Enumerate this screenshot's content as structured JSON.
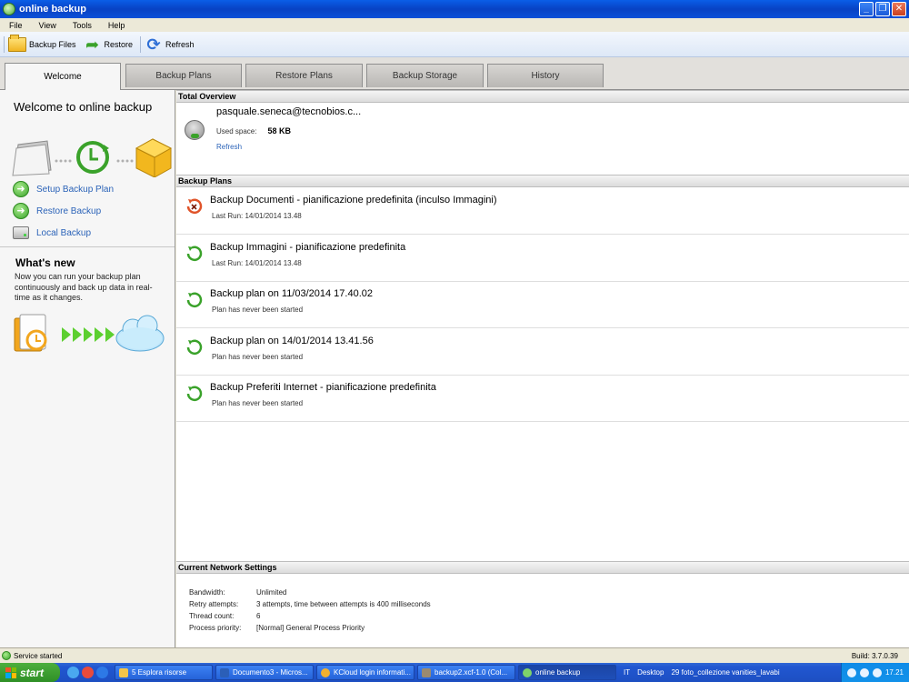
{
  "window": {
    "title": "online backup",
    "min": "_",
    "max": "❐",
    "close": "✕"
  },
  "menu": [
    "File",
    "View",
    "Tools",
    "Help"
  ],
  "toolbar": {
    "backup_files": "Backup Files",
    "restore": "Restore",
    "refresh": "Refresh"
  },
  "tabs": [
    "Welcome",
    "Backup Plans",
    "Restore Plans",
    "Backup Storage",
    "History"
  ],
  "left": {
    "welcome_title": "Welcome to online backup",
    "links": {
      "setup": "Setup Backup Plan",
      "restore": "Restore Backup",
      "local": "Local Backup"
    },
    "whats_new_title": "What's new",
    "whats_new_text": "Now you can run your backup plan continuously and back up data in real-time as it changes."
  },
  "overview": {
    "header": "Total Overview",
    "account": "pasquale.seneca@tecnobios.c...",
    "used_label": "Used space:",
    "used_value": "58 KB",
    "refresh": "Refresh"
  },
  "plans": {
    "header": "Backup Plans",
    "items": [
      {
        "name": "Backup Documenti - pianificazione predefinita (inculso Immagini)",
        "status": "Last Run: 14/01/2014 13.48",
        "icon": "error-refresh-icon"
      },
      {
        "name": "Backup Immagini - pianificazione predefinita",
        "status": "Last Run: 14/01/2014 13.48",
        "icon": "green-refresh-icon"
      },
      {
        "name": "Backup plan on 11/03/2014 17.40.02",
        "status": "Plan has never been started",
        "icon": "green-refresh-icon"
      },
      {
        "name": "Backup plan on 14/01/2014 13.41.56",
        "status": "Plan has never been started",
        "icon": "green-refresh-icon"
      },
      {
        "name": "Backup Preferiti Internet - pianificazione predefinita",
        "status": "Plan has never been started",
        "icon": "green-refresh-icon"
      }
    ]
  },
  "network": {
    "header": "Current Network Settings",
    "rows": [
      {
        "key": "Bandwidth:",
        "value": "Unlimited"
      },
      {
        "key": "Retry attempts:",
        "value": "3 attempts, time between attempts is 400 milliseconds"
      },
      {
        "key": "Thread count:",
        "value": "6"
      },
      {
        "key": "Process priority:",
        "value": "[Normal] General Process Priority"
      }
    ]
  },
  "status": {
    "text": "Service started",
    "build": "Build: 3.7.0.39"
  },
  "taskbar": {
    "start": "start",
    "tasks": [
      "5 Esplora risorse",
      "Documento3 - Micros...",
      "KCloud login informati...",
      "backup2.xcf-1.0 (Col...",
      "online backup"
    ],
    "lang": "IT",
    "desktop": "Desktop",
    "extra": "29 foto_collezione vanities_lavabi",
    "clock": "17.21"
  },
  "colors": {
    "link": "#2b63b8",
    "accent_green": "#3aa22a",
    "error_orange": "#e0542a",
    "xp_blue": "#0a50d8"
  }
}
